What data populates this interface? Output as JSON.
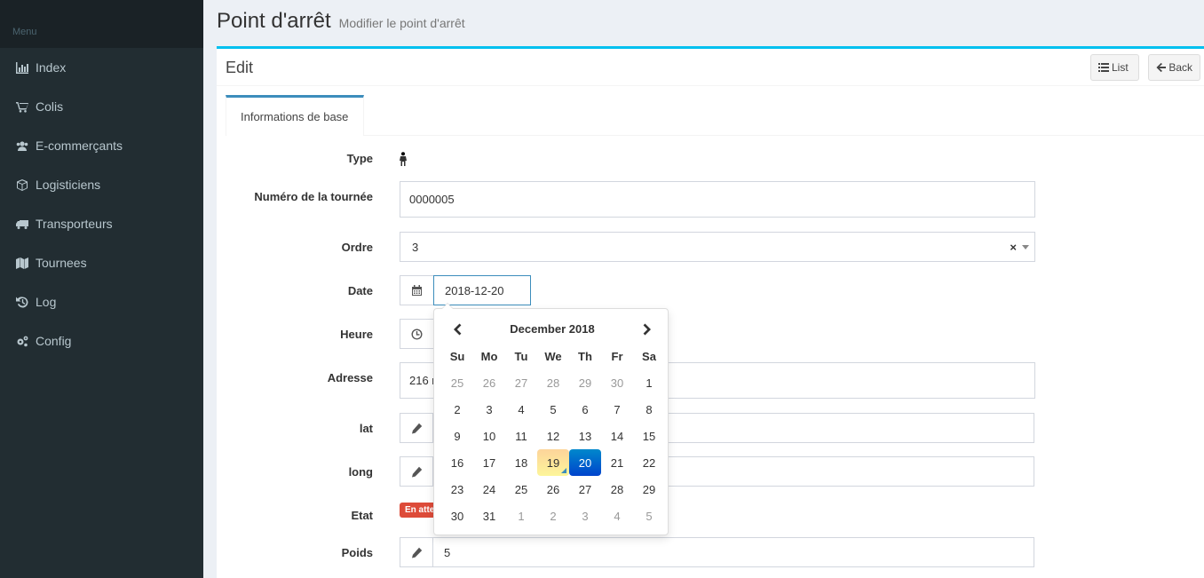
{
  "sidebar": {
    "header": "Menu",
    "items": [
      {
        "label": "Index",
        "icon": "bar-chart-icon"
      },
      {
        "label": "Colis",
        "icon": "cart-icon"
      },
      {
        "label": "E-commerçants",
        "icon": "users-icon"
      },
      {
        "label": "Logisticiens",
        "icon": "cube-icon"
      },
      {
        "label": "Transporteurs",
        "icon": "truck-icon"
      },
      {
        "label": "Tournees",
        "icon": "map-icon"
      },
      {
        "label": "Log",
        "icon": "history-icon"
      },
      {
        "label": "Config",
        "icon": "cogs-icon"
      }
    ]
  },
  "page": {
    "title": "Point d'arrêt",
    "subtitle": "Modifier le point d'arrêt"
  },
  "box": {
    "title": "Edit",
    "list_label": "List",
    "back_label": "Back"
  },
  "tabs": [
    {
      "label": "Informations de base"
    }
  ],
  "form": {
    "type_label": "Type",
    "tournee_label": "Numéro de la tournée",
    "tournee_value": "0000005",
    "ordre_label": "Ordre",
    "ordre_value": "3",
    "ordre_clear": "×",
    "date_label": "Date",
    "date_value": "2018-12-20",
    "heure_label": "Heure",
    "adresse_label": "Adresse",
    "adresse_value": "216 r",
    "lat_label": "lat",
    "long_label": "long",
    "etat_label": "Etat",
    "etat_badge": "En atte",
    "poids_label": "Poids",
    "poids_value": "5"
  },
  "datepicker": {
    "title": "December 2018",
    "dow": [
      "Su",
      "Mo",
      "Tu",
      "We",
      "Th",
      "Fr",
      "Sa"
    ],
    "weeks": [
      [
        {
          "d": "25",
          "o": true
        },
        {
          "d": "26",
          "o": true
        },
        {
          "d": "27",
          "o": true
        },
        {
          "d": "28",
          "o": true
        },
        {
          "d": "29",
          "o": true
        },
        {
          "d": "30",
          "o": true
        },
        {
          "d": "1"
        }
      ],
      [
        {
          "d": "2"
        },
        {
          "d": "3"
        },
        {
          "d": "4"
        },
        {
          "d": "5"
        },
        {
          "d": "6"
        },
        {
          "d": "7"
        },
        {
          "d": "8"
        }
      ],
      [
        {
          "d": "9"
        },
        {
          "d": "10"
        },
        {
          "d": "11"
        },
        {
          "d": "12"
        },
        {
          "d": "13"
        },
        {
          "d": "14"
        },
        {
          "d": "15"
        }
      ],
      [
        {
          "d": "16"
        },
        {
          "d": "17"
        },
        {
          "d": "18"
        },
        {
          "d": "19",
          "today": true
        },
        {
          "d": "20",
          "active": true
        },
        {
          "d": "21"
        },
        {
          "d": "22"
        }
      ],
      [
        {
          "d": "23"
        },
        {
          "d": "24"
        },
        {
          "d": "25"
        },
        {
          "d": "26"
        },
        {
          "d": "27"
        },
        {
          "d": "28"
        },
        {
          "d": "29"
        }
      ],
      [
        {
          "d": "30"
        },
        {
          "d": "31"
        },
        {
          "d": "1",
          "o": true
        },
        {
          "d": "2",
          "o": true
        },
        {
          "d": "3",
          "o": true
        },
        {
          "d": "4",
          "o": true
        },
        {
          "d": "5",
          "o": true
        }
      ]
    ]
  },
  "colors": {
    "sidebar_bg": "#222d32",
    "accent": "#00c0ef",
    "tab_accent": "#3c8dbc",
    "badge_red": "#dd4b39",
    "active_day": "#0068cc"
  }
}
